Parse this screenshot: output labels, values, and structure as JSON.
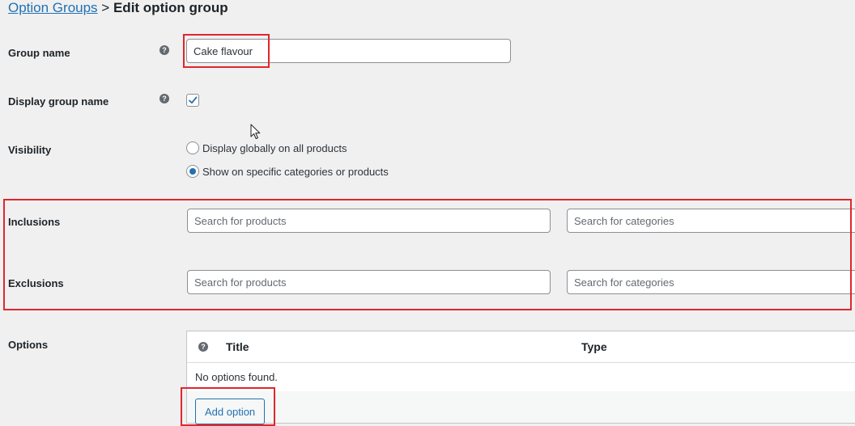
{
  "breadcrumb": {
    "parent": "Option Groups",
    "separator": ">",
    "current": "Edit option group"
  },
  "fields": {
    "group_name": {
      "label": "Group name",
      "value": "Cake flavour"
    },
    "display_group_name": {
      "label": "Display group name",
      "checked": true
    },
    "visibility": {
      "label": "Visibility",
      "options": [
        {
          "label": "Display globally on all products",
          "selected": false
        },
        {
          "label": "Show on specific categories or products",
          "selected": true
        }
      ]
    },
    "inclusions": {
      "label": "Inclusions",
      "products_placeholder": "Search for products",
      "categories_placeholder": "Search for categories"
    },
    "exclusions": {
      "label": "Exclusions",
      "products_placeholder": "Search for products",
      "categories_placeholder": "Search for categories"
    }
  },
  "options": {
    "label": "Options",
    "columns": [
      "Title",
      "Type"
    ],
    "empty_text": "No options found.",
    "add_button": "Add option"
  },
  "colors": {
    "accent": "#2271b1",
    "highlight": "#e0262c",
    "background": "#f0f0f1"
  },
  "icons": {
    "help": "question-mark-circle-icon",
    "check": "checkmark-icon",
    "cursor": "mouse-pointer-icon"
  }
}
